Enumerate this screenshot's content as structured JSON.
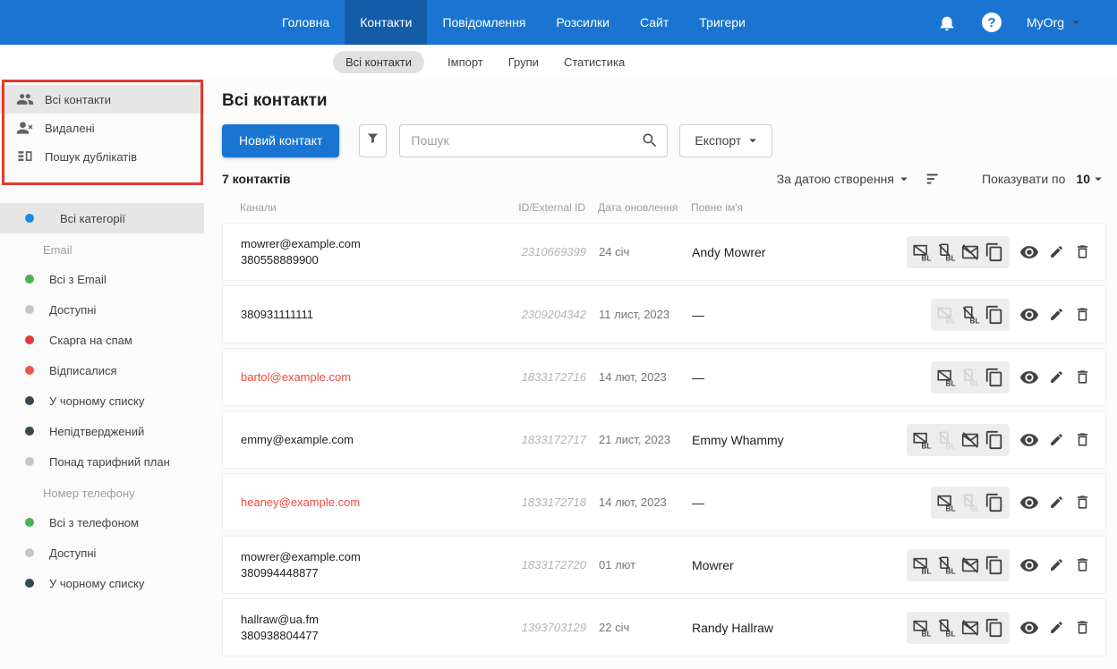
{
  "colors": {
    "accent": "#1a75d2",
    "annotation": "#e23b2e",
    "red_text": "#f4483c"
  },
  "header": {
    "nav": [
      {
        "label": "Головна",
        "active": false
      },
      {
        "label": "Контакти",
        "active": true
      },
      {
        "label": "Повідомлення",
        "active": false
      },
      {
        "label": "Розсилки",
        "active": false
      },
      {
        "label": "Сайт",
        "active": false
      },
      {
        "label": "Тригери",
        "active": false
      }
    ],
    "help_glyph": "?",
    "org_name": "MyOrg"
  },
  "subnav": [
    {
      "label": "Всі контакти",
      "active": true
    },
    {
      "label": "Імпорт",
      "active": false
    },
    {
      "label": "Групи",
      "active": false
    },
    {
      "label": "Статистика",
      "active": false
    }
  ],
  "sidebar": {
    "top_items": [
      {
        "label": "Всі контакти",
        "icon": "contacts-icon",
        "active": true
      },
      {
        "label": "Видалені",
        "icon": "person-remove-icon",
        "active": false
      },
      {
        "label": "Пошук дублікатів",
        "icon": "duplicates-icon",
        "active": false
      }
    ],
    "all_categories": {
      "label": "Всі категорії",
      "dot_color": "#1e88e5",
      "active": true
    },
    "sections": [
      {
        "title": "Email",
        "items": [
          {
            "label": "Всі з Email",
            "dot_color": "#4caf50"
          },
          {
            "label": "Доступні",
            "dot_color": "#c5c5c5"
          },
          {
            "label": "Скарга на спам",
            "dot_color": "#e53935"
          },
          {
            "label": "Відписалися",
            "dot_color": "#ef5350"
          },
          {
            "label": "У чорному списку",
            "dot_color": "#37474f"
          },
          {
            "label": "Непідтверджений",
            "dot_color": "#37474f"
          },
          {
            "label": "Понад тарифний план",
            "dot_color": "#c5c5c5"
          }
        ]
      },
      {
        "title": "Номер телефону",
        "items": [
          {
            "label": "Всі з телефоном",
            "dot_color": "#4caf50"
          },
          {
            "label": "Доступні",
            "dot_color": "#c5c5c5"
          },
          {
            "label": "У чорному списку",
            "dot_color": "#37474f"
          }
        ]
      }
    ]
  },
  "main": {
    "title": "Всі контакти",
    "new_contact_label": "Новий контакт",
    "search_placeholder": "Пошук",
    "export_label": "Експорт",
    "count_label": "7 контактів",
    "sort_label": "За датою створення",
    "show_label": "Показувати по",
    "per_page": "10",
    "table": {
      "headers": [
        "Канали",
        "ID/External ID",
        "Дата оновлення",
        "Повне ім'я"
      ],
      "rows": [
        {
          "channels": [
            "mowrer@example.com",
            "380558889900"
          ],
          "red": false,
          "id": "2310669399",
          "updated": "24 січ",
          "name": "Andy Mowrer",
          "actions": [
            {
              "icon": "blacklist-email-icon",
              "enabled": true
            },
            {
              "icon": "blacklist-phone-icon",
              "enabled": true
            },
            {
              "icon": "unsubscribe-email-icon",
              "enabled": true
            },
            {
              "icon": "copy-icon",
              "enabled": true
            }
          ]
        },
        {
          "channels": [
            "380931111111"
          ],
          "red": false,
          "id": "2309204342",
          "updated": "11 лист, 2023",
          "name": "—",
          "actions": [
            {
              "icon": "blacklist-email-icon",
              "enabled": false
            },
            {
              "icon": "blacklist-phone-icon",
              "enabled": true
            },
            {
              "icon": "copy-icon",
              "enabled": true
            }
          ]
        },
        {
          "channels": [
            "bartol@example.com"
          ],
          "red": true,
          "id": "1833172716",
          "updated": "14 лют, 2023",
          "name": "—",
          "actions": [
            {
              "icon": "blacklist-email-icon",
              "enabled": true
            },
            {
              "icon": "blacklist-phone-icon",
              "enabled": false
            },
            {
              "icon": "copy-icon",
              "enabled": true
            }
          ]
        },
        {
          "channels": [
            "emmy@example.com"
          ],
          "red": false,
          "id": "1833172717",
          "updated": "21 лист, 2023",
          "name": "Emmy Whammy",
          "actions": [
            {
              "icon": "blacklist-email-icon",
              "enabled": true
            },
            {
              "icon": "blacklist-phone-icon",
              "enabled": false
            },
            {
              "icon": "unsubscribe-email-icon",
              "enabled": true
            },
            {
              "icon": "copy-icon",
              "enabled": true
            }
          ]
        },
        {
          "channels": [
            "heaney@example.com"
          ],
          "red": true,
          "id": "1833172718",
          "updated": "14 лют, 2023",
          "name": "—",
          "actions": [
            {
              "icon": "blacklist-email-icon",
              "enabled": true
            },
            {
              "icon": "blacklist-phone-icon",
              "enabled": false
            },
            {
              "icon": "copy-icon",
              "enabled": true
            }
          ]
        },
        {
          "channels": [
            "mowrer@example.com",
            "380994448877"
          ],
          "red": false,
          "id": "1833172720",
          "updated": "01 лют",
          "name": "Mowrer",
          "actions": [
            {
              "icon": "blacklist-email-icon",
              "enabled": true
            },
            {
              "icon": "blacklist-phone-icon",
              "enabled": true
            },
            {
              "icon": "unsubscribe-email-icon",
              "enabled": true
            },
            {
              "icon": "copy-icon",
              "enabled": true
            }
          ]
        },
        {
          "channels": [
            "hallraw@ua.fm",
            "380938804477"
          ],
          "red": false,
          "id": "1393703129",
          "updated": "22 січ",
          "name": "Randy Hallraw",
          "actions": [
            {
              "icon": "blacklist-email-icon",
              "enabled": true
            },
            {
              "icon": "blacklist-phone-icon",
              "enabled": true
            },
            {
              "icon": "unsubscribe-email-icon",
              "enabled": true
            },
            {
              "icon": "copy-icon",
              "enabled": true
            }
          ]
        }
      ]
    }
  }
}
